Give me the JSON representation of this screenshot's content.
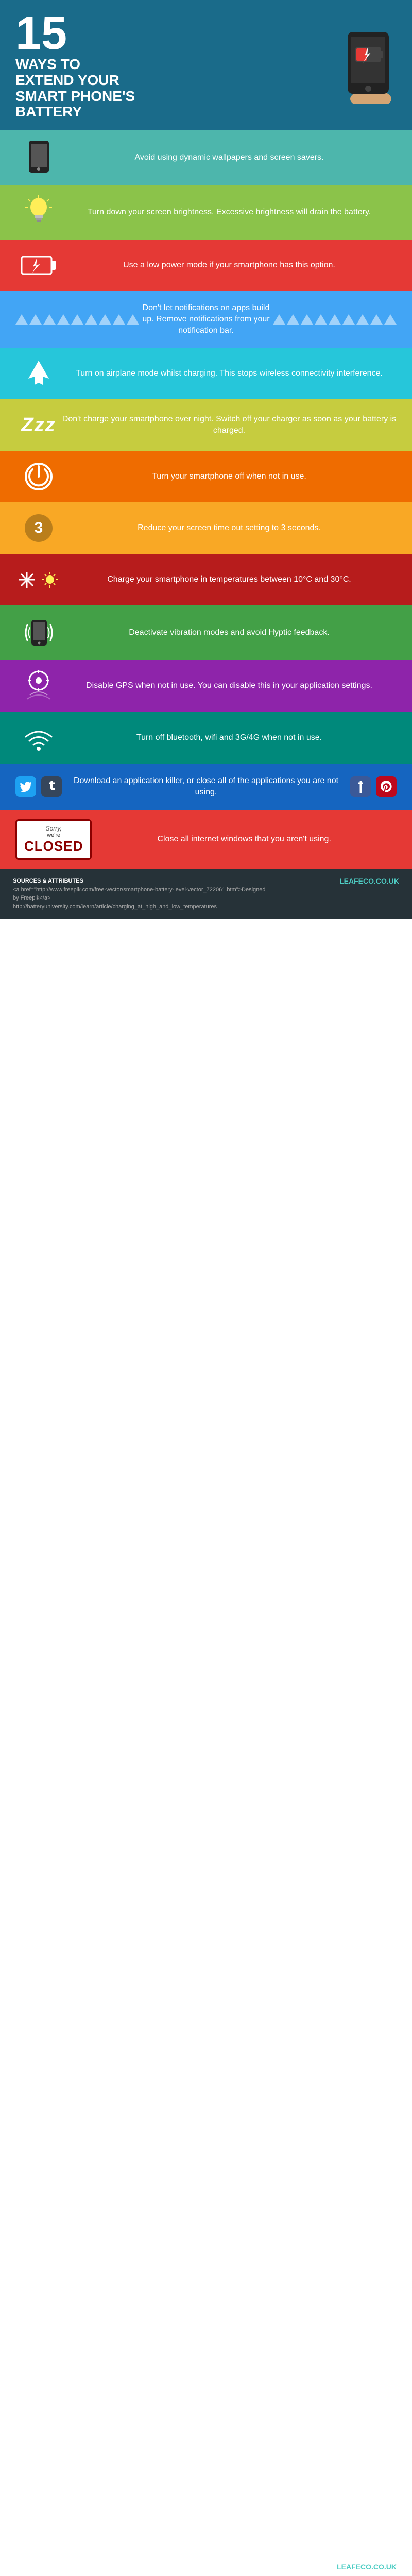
{
  "header": {
    "number": "15",
    "line1": "WAYS TO",
    "line2": "EXTEND YOUR",
    "line3": "SMART PHONE'S",
    "line4": "BATTERY",
    "logo": "LEAFECO.CO.UK"
  },
  "tips": [
    {
      "id": 1,
      "bg": "bg-teal",
      "text": "Avoid using dynamic wallpapers and screen savers.",
      "icon_type": "phone"
    },
    {
      "id": 2,
      "bg": "bg-green-light",
      "text": "Turn down your screen brightness. Excessive brightness will drain the battery.",
      "icon_type": "bulb"
    },
    {
      "id": 3,
      "bg": "bg-red",
      "text": "Use a low power mode if your smartphone has this option.",
      "icon_type": "battery"
    },
    {
      "id": 4,
      "bg": "bg-blue",
      "text": "Don't let notifications on apps build up. Remove notifications from your notification bar.",
      "icon_type": "triangles"
    },
    {
      "id": 5,
      "bg": "bg-cyan",
      "text": "Turn on airplane mode whilst charging. This stops wireless connectivity interference.",
      "icon_type": "plane"
    },
    {
      "id": 6,
      "bg": "bg-yellow-green",
      "text": "Don't charge your smartphone over night. Switch off your charger as soon as your battery is charged.",
      "icon_type": "zzz"
    },
    {
      "id": 7,
      "bg": "bg-orange",
      "text": "Turn your smartphone off when not in use.",
      "icon_type": "power"
    },
    {
      "id": 8,
      "bg": "bg-amber",
      "text": "Reduce your screen time out setting to 3 seconds.",
      "icon_type": "three"
    },
    {
      "id": 9,
      "bg": "bg-red-dark",
      "text": "Charge your smartphone in temperatures between 10°C and 30°C.",
      "icon_type": "temp"
    },
    {
      "id": 10,
      "bg": "bg-green",
      "text": "Deactivate vibration modes and avoid Hyptic feedback.",
      "icon_type": "phone-vibrate"
    },
    {
      "id": 11,
      "bg": "bg-purple",
      "text": "Disable GPS when not in use. You can disable this in your application settings.",
      "icon_type": "gps"
    },
    {
      "id": 12,
      "bg": "bg-teal-dark",
      "text": "Turn off bluetooth, wifi and 3G/4G when not in use.",
      "icon_type": "wifi"
    },
    {
      "id": 13,
      "bg": "bg-pink",
      "text": "Download an application killer, or close all of the applications you are not using.",
      "icon_type": "social"
    },
    {
      "id": 14,
      "bg": "bg-red",
      "text": "Close all internet windows that you aren't using.",
      "icon_type": "closed"
    }
  ],
  "footer": {
    "sources_title": "SOURCES & ATTRIBUTES",
    "link1_text": "<a href=\"http://www.freepik.com/free-vector/smartphone-battery-level-vector_722061.htm\">Designed by Freepik</a>",
    "link2_text": "http://batteryuniversity.com/learn/article/charging_at_high_and_low_temperatures",
    "logo": "LEAFECO.CO.UK"
  }
}
